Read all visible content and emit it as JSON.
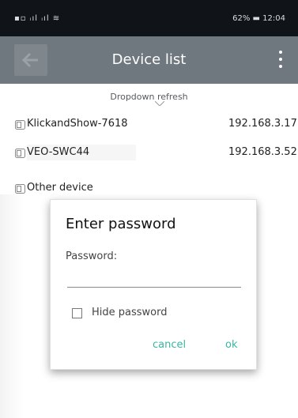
{
  "status_bar": {
    "left_icons": "▪▫ ᵢıl ᵢıl ≋",
    "battery": "62%",
    "time": "12:04"
  },
  "app_bar": {
    "title": "Device list",
    "back_icon": "back-arrow-icon",
    "menu_icon": "overflow-menu-icon"
  },
  "list": {
    "refresh_hint": "Dropdown refresh",
    "devices": [
      {
        "name": "KlickandShow-7618",
        "ip": "192.168.3.17"
      },
      {
        "name": "VEO-SWC44",
        "ip": "192.168.3.52"
      },
      {
        "name": "Other device",
        "ip": ""
      }
    ]
  },
  "dialog": {
    "title": "Enter password",
    "password_label": "Password:",
    "password_value": "",
    "hide_password_label": "Hide password",
    "hide_password_checked": false,
    "cancel_label": "cancel",
    "ok_label": "ok"
  },
  "colors": {
    "status_bar_bg": "#101418",
    "app_bar_bg": "#70787f",
    "accent": "#3ab6a3"
  }
}
